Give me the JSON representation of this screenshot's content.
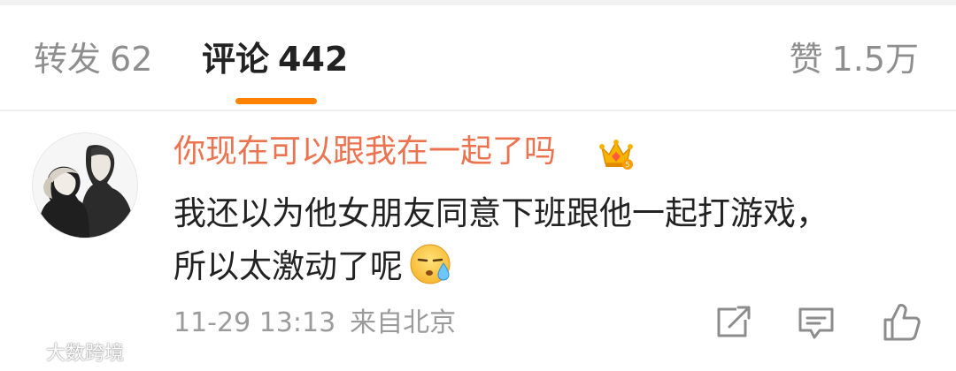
{
  "tabs": {
    "repost": {
      "label": "转发",
      "count": "62"
    },
    "comments": {
      "label": "评论",
      "count": "442"
    },
    "likes": {
      "label": "赞",
      "count": "1.5万"
    },
    "active": "comments",
    "accent_color": "#ff8200"
  },
  "comment": {
    "username": "你现在可以跟我在一起了吗",
    "username_color": "#eb7350",
    "badge_icon": "crown-badge-icon",
    "text_lines": [
      "我还以为他女朋友同意下班跟他一起打游戏，",
      "所以太激动了呢"
    ],
    "emoji_icon": "sweat-emoji-icon",
    "timestamp": "11-29 13:13",
    "location": "来自北京",
    "actions": [
      "share-icon",
      "reply-icon",
      "like-icon"
    ]
  },
  "watermark": {
    "text": "大数跨境"
  }
}
